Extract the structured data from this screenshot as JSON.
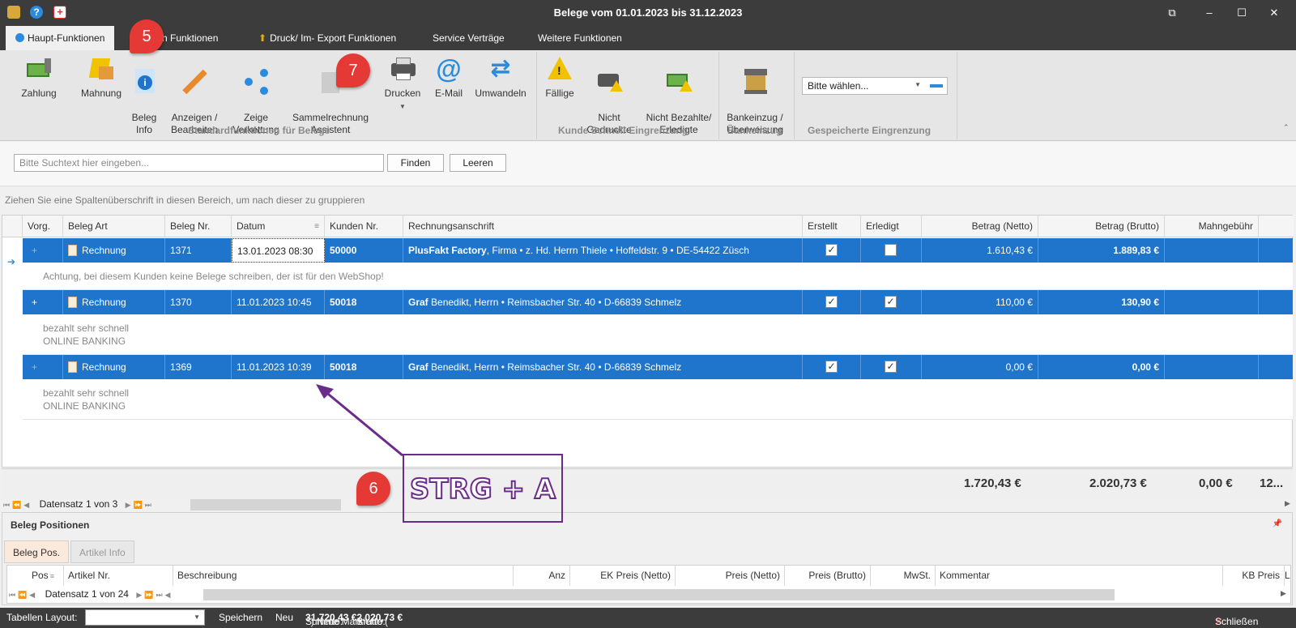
{
  "window": {
    "title": "Belege vom 01.01.2023 bis 31.12.2023"
  },
  "ribbon_tabs": [
    {
      "label": "Haupt-Funktionen"
    },
    {
      "label": "ch Funktionen"
    },
    {
      "label": "Druck/ Im- Export Funktionen"
    },
    {
      "label": "Service Verträge"
    },
    {
      "label": "Weitere Funktionen"
    }
  ],
  "ribbon": {
    "buttons": [
      {
        "label": "Zahlung",
        "icon": "money-icon"
      },
      {
        "label": "Mahnung",
        "icon": "reminder-icon"
      },
      {
        "label": "Beleg\nInfo",
        "icon": "info-icon"
      },
      {
        "label": "Anzeigen /\nBearbeiten",
        "icon": "pencil-icon"
      },
      {
        "label": "Zeige\nVerkettung",
        "icon": "share-icon"
      },
      {
        "label": "Sammelrechnung\nAssistent",
        "icon": "wizard-icon"
      },
      {
        "label": "Drucken",
        "icon": "printer-icon"
      },
      {
        "label": "E-Mail",
        "icon": "at-icon"
      },
      {
        "label": "Umwandeln",
        "icon": "convert-icon"
      },
      {
        "label": "Fällige",
        "icon": "warning-icon"
      },
      {
        "label": "Nicht\nGedruckte",
        "icon": "printer-warning-icon"
      },
      {
        "label": "Nicht Bezahlte/\nErledigte",
        "icon": "money-warning-icon"
      },
      {
        "label": "Bankeinzug /\nÜberweisung",
        "icon": "bank-icon"
      }
    ],
    "groups": [
      {
        "label": "Standardfunktionen für Belege"
      },
      {
        "label": "Kunde Schnell-Eingrenzung"
      },
      {
        "label": "Bankeinzug"
      },
      {
        "label": "Gespeicherte Eingrenzung"
      }
    ],
    "saved_filter": {
      "value": "Bitte wählen..."
    }
  },
  "search": {
    "placeholder": "Bitte Suchtext hier eingeben...",
    "find_label": "Finden",
    "clear_label": "Leeren"
  },
  "group_hint": "Ziehen Sie eine Spaltenüberschrift in diesen Bereich, um nach dieser zu gruppieren",
  "grid": {
    "columns": [
      "Vorg.",
      "Beleg Art",
      "Beleg Nr.",
      "Datum",
      "Kunden Nr.",
      "Rechnungsanschrift",
      "Erstellt",
      "Erledigt",
      "Betrag (Netto)",
      "Betrag (Brutto)",
      "Mahngebühr"
    ],
    "rows": [
      {
        "expand": "+",
        "type": "Rechnung",
        "number": "1371",
        "date": "13.01.2023 08:30",
        "customer": "50000",
        "addr_name": "PlusFakt Factory",
        "addr_rest": ", Firma • z. Hd. Herrn Thiele • Hoffeldstr. 9 • DE-54422 Züsch",
        "created": true,
        "done": false,
        "net": "1.610,43 €",
        "gross": "1.889,83 €",
        "note": [
          "Achtung, bei diesem Kunden keine Belege schreiben, der ist für den WebShop!"
        ]
      },
      {
        "expand": "+",
        "type": "Rechnung",
        "number": "1370",
        "date": "11.01.2023 10:45",
        "customer": "50018",
        "addr_name": "Graf",
        "addr_rest": " Benedikt, Herrn • Reimsbacher Str. 40 • D-66839 Schmelz",
        "created": true,
        "done": true,
        "net": "110,00 €",
        "gross": "130,90 €",
        "note": [
          "bezahlt sehr schnell",
          "ONLINE BANKING"
        ]
      },
      {
        "expand": "+",
        "type": "Rechnung",
        "number": "1369",
        "date": "11.01.2023 10:39",
        "customer": "50018",
        "addr_name": "Graf",
        "addr_rest": " Benedikt, Herrn • Reimsbacher Str. 40 • D-66839 Schmelz",
        "created": true,
        "done": true,
        "net": "0,00 €",
        "gross": "0,00 €",
        "note": [
          "bezahlt sehr schnell",
          "ONLINE BANKING"
        ]
      }
    ],
    "totals": {
      "net": "1.720,43 €",
      "gross": "2.020,73 €",
      "fee": "0,00 €",
      "more": "12..."
    },
    "nav": "Datensatz 1 von 3"
  },
  "positions_panel": {
    "title": "Beleg Positionen",
    "tabs": [
      "Beleg Pos.",
      "Artikel Info"
    ],
    "columns": [
      "Pos",
      "Artikel Nr.",
      "Beschreibung",
      "Anz",
      "EK Preis (Netto)",
      "Preis (Netto)",
      "Preis (Brutto)",
      "MwSt.",
      "Kommentar",
      "KB Preis",
      "L"
    ],
    "nav": "Datensatz 1 von 24"
  },
  "statusbar": {
    "layout_label": "Tabellen Layout:",
    "save_label": "Speichern",
    "new_label": "Neu",
    "sum_prefix": "Summe Markierte (",
    "sum_count": "3",
    "sum_mid": ") Netto: ",
    "sum_net": "1.720,43 €",
    "sum_gross_label": " Brutto: ",
    "sum_gross": "2.020,73 €",
    "close_label": "Schließen"
  },
  "annotations": {
    "badge5": "5",
    "badge6": "6",
    "badge7": "7",
    "shortcut": "STRG + A"
  }
}
